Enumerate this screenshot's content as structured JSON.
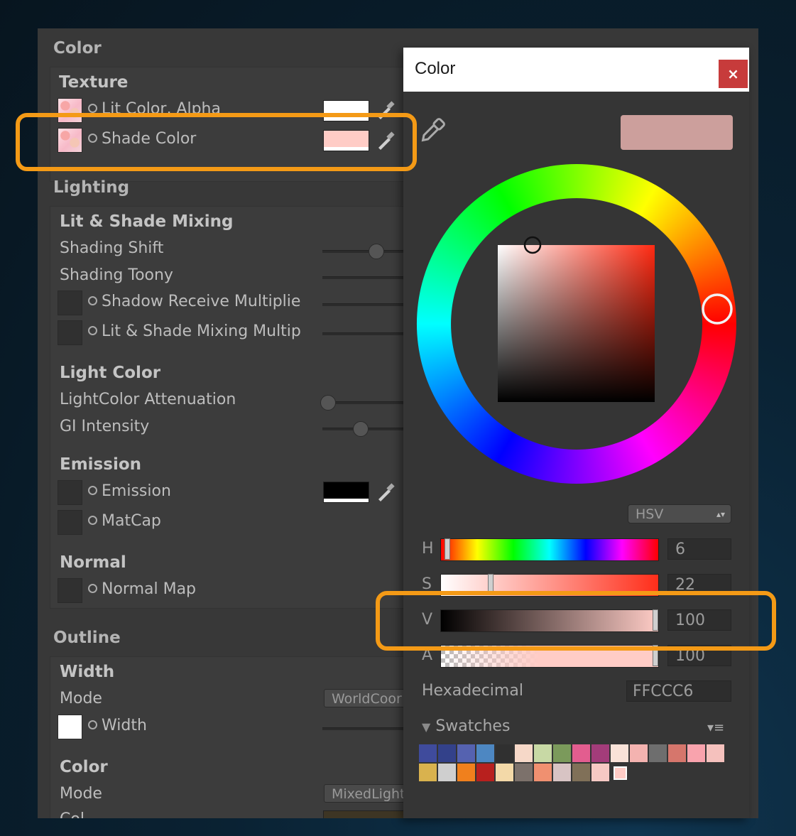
{
  "inspector": {
    "color_section": "Color",
    "texture_group": "Texture",
    "lit_color_alpha": "Lit Color, Alpha",
    "shade_color": "Shade Color",
    "lighting_section": "Lighting",
    "lit_shade_mixing": "Lit & Shade Mixing",
    "shading_shift": "Shading Shift",
    "shading_toony": "Shading Toony",
    "shadow_receive": "Shadow Receive Multiplie",
    "lit_shade_multip": "Lit & Shade Mixing Multip",
    "light_color": "Light Color",
    "lightcolor_attenuation": "LightColor Attenuation",
    "gi_intensity": "GI Intensity",
    "emission_group": "Emission",
    "emission": "Emission",
    "matcap": "MatCap",
    "normal_group": "Normal",
    "normal_map": "Normal Map",
    "outline_section": "Outline",
    "width_group": "Width",
    "mode_label": "Mode",
    "width_mode_value": "WorldCoor",
    "width_label": "Width",
    "color_group": "Color",
    "color_mode_label": "Mode",
    "color_mode_value": "MixedLight",
    "color_label_cut": "Col",
    "lit_color_value": "#ffffff",
    "shade_color_value": "#ffccc6",
    "emission_color_value": "#000000"
  },
  "color_window": {
    "title": "Color",
    "close_label": "×",
    "preview_color": "#cc9f9c",
    "mode": "HSV",
    "channels": [
      {
        "label": "H",
        "value": "6",
        "level": 0.017
      },
      {
        "label": "S",
        "value": "22",
        "level": 0.22
      },
      {
        "label": "V",
        "value": "100",
        "level": 1.0
      },
      {
        "label": "A",
        "value": "100",
        "level": 1.0
      }
    ],
    "hex_label": "Hexadecimal",
    "hex_value": "FFCCC6",
    "swatches_label": "Swatches",
    "swatches_row1": [
      "#3f4b9c",
      "#33418a",
      "#5562b0",
      "#4d87c2",
      "#303030",
      "#f6d8c8",
      "#c8d9a5",
      "#7b9a5b",
      "#e35d8f",
      "#a33c7a",
      "#f9e2d8",
      "#f4b3b0",
      "#6e6e6e",
      "#d6766c",
      "#f9a3ad",
      "#f5c1bd"
    ],
    "swatches_row2": [
      "#d9b24e",
      "#cfcfcf",
      "#f0801d",
      "#b8201e",
      "#f3d9a8",
      "#7c716b",
      "#f09070",
      "#d8c4c4",
      "#807058",
      "#f6c9c4"
    ]
  }
}
